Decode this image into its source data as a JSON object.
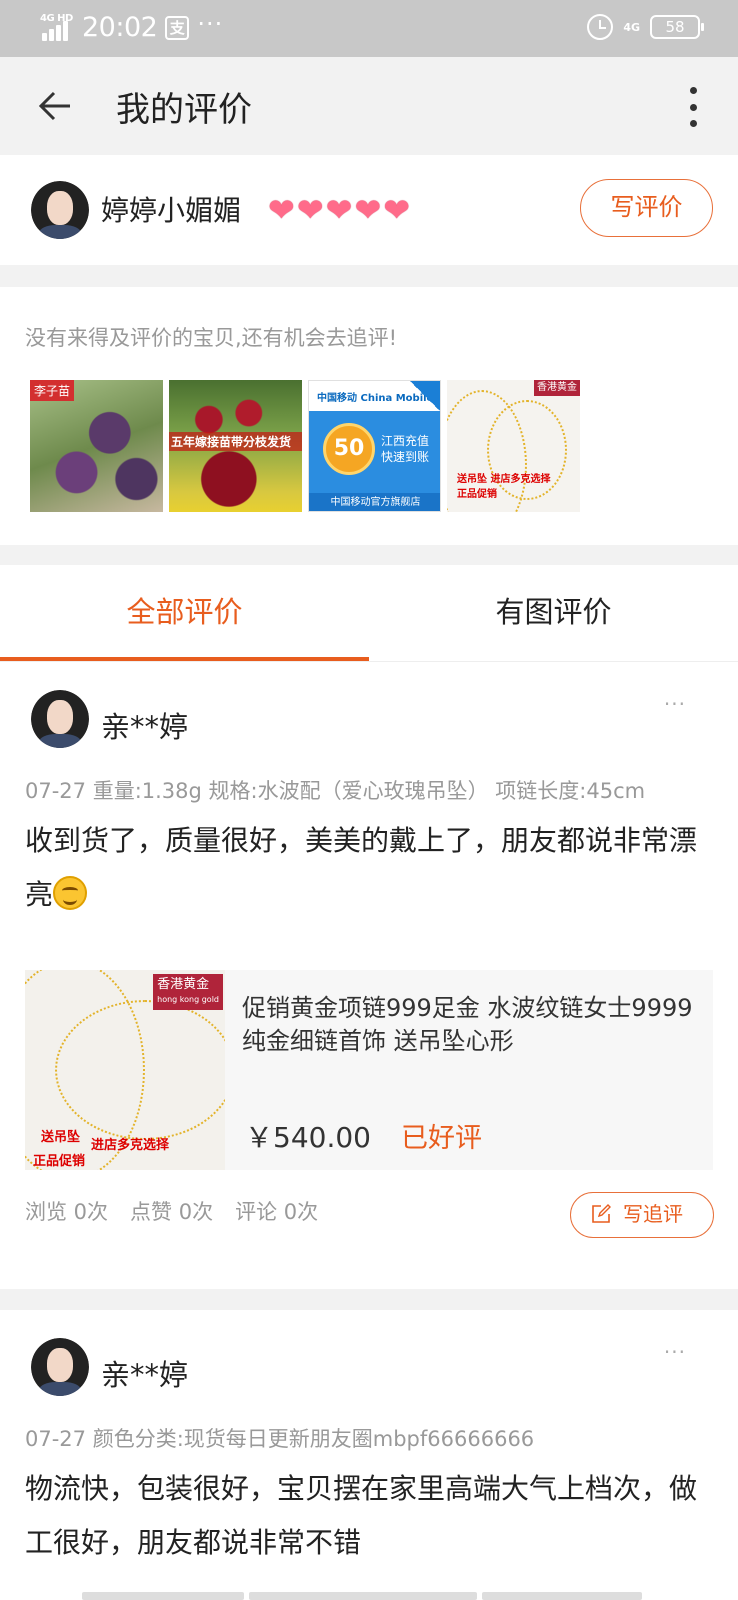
{
  "status_bar": {
    "network": "4G HD",
    "time": "20:02",
    "pay_icon": "支",
    "more": "···",
    "net_right": "4G",
    "battery": "58"
  },
  "nav": {
    "title": "我的评价"
  },
  "profile": {
    "username": "婷婷小媚媚",
    "hearts": [
      "❤",
      "❤",
      "❤",
      "❤",
      "❤"
    ],
    "write_review": "写评价"
  },
  "pending": {
    "text": "没有来得及评价的宝贝,还有机会去追评!",
    "items": [
      {
        "tag": "李子苗"
      },
      {
        "banner": "五年嫁接苗带分枝发货"
      },
      {
        "logo": "中国移动 China Mobile",
        "coin": "50",
        "line1": "江西充值",
        "line2": "快速到账",
        "footer": "中国移动官方旗舰店"
      },
      {
        "label": "香港黄金",
        "red1": "送吊坠",
        "red2": "进店多克选择",
        "red3": "正品促销"
      }
    ]
  },
  "tabs": {
    "all": "全部评价",
    "with_images": "有图评价"
  },
  "review1": {
    "name": "亲**婷",
    "more": "···",
    "meta": "07-27  重量:1.38g 规格:水波配（爱心玫瑰吊坠） 项链长度:45cm",
    "content": "收到货了，质量很好，美美的戴上了，朋友都说非常漂亮",
    "product": {
      "image_label": "香港黄金",
      "image_sublabel": "hong kong gold",
      "badge1": "送吊坠",
      "badge2": "进店多克选择",
      "badge3": "正品促销",
      "title": "促销黄金项链999足金 水波纹链女士9999纯金细链首饰 送吊坠心形",
      "price": "￥540.00",
      "status": "已好评"
    },
    "stats": {
      "views": "浏览 0次",
      "likes": "点赞 0次",
      "comments": "评论 0次"
    },
    "follow_up": "写追评"
  },
  "review2": {
    "name": "亲**婷",
    "more": "···",
    "meta": "07-27  颜色分类:现货每日更新朋友圈mbpf66666666",
    "content": " 物流快，包装很好，宝贝摆在家里高端大气上档次，做工很好，朋友都说非常不错"
  },
  "colors": {
    "accent": "#e85d1e",
    "muted": "#999999",
    "status_bar": "#c8c8c8"
  }
}
